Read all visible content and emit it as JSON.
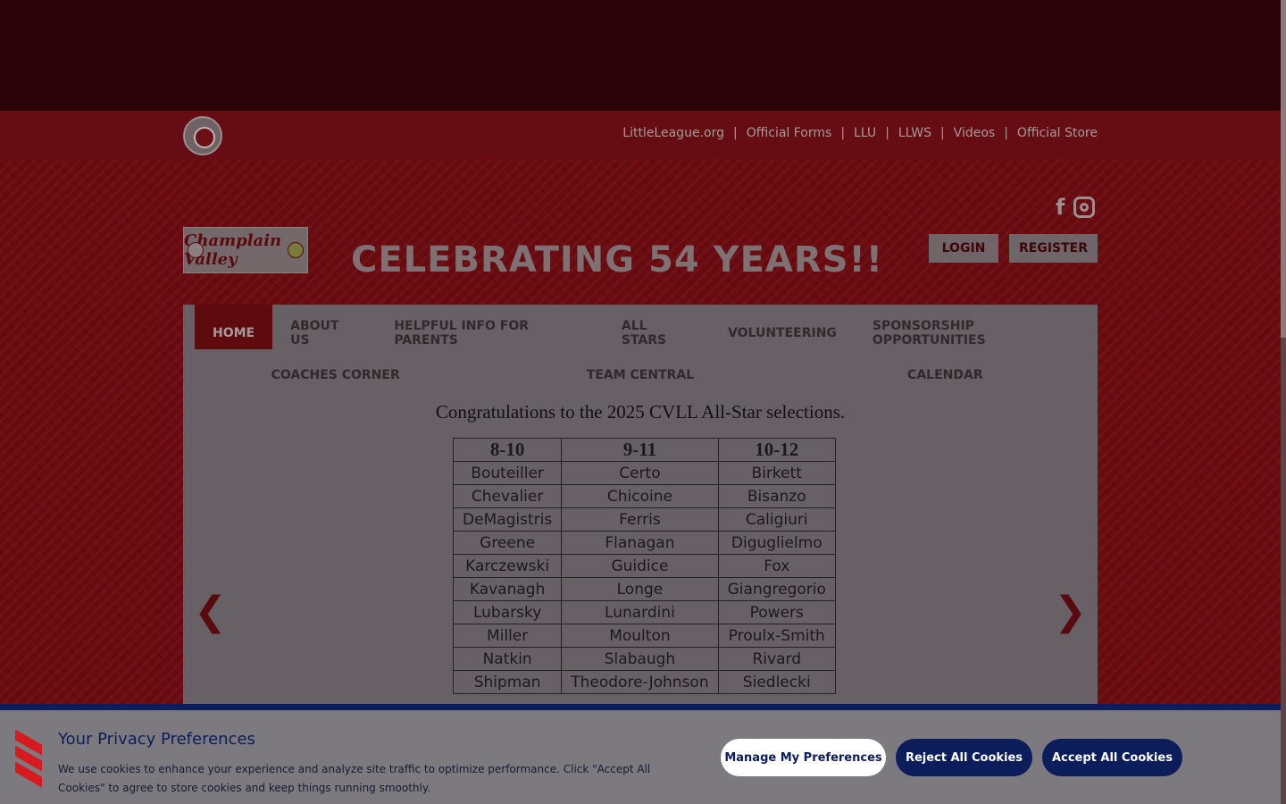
{
  "top_links": [
    "LittleLeague.org",
    "Official Forms",
    "LLU",
    "LLWS",
    "Videos",
    "Official Store"
  ],
  "league_logo_text": "Champlain Valley",
  "celebrate": "CELEBRATING 54 YEARS!!",
  "auth": {
    "login": "LOGIN",
    "register": "REGISTER"
  },
  "nav": {
    "row1": [
      "HOME",
      "ABOUT US",
      "HELPFUL INFO FOR PARENTS",
      "ALL STARS",
      "VOLUNTEERING",
      "SPONSORSHIP OPPORTUNITIES"
    ],
    "row2": [
      "COACHES CORNER",
      "TEAM CENTRAL",
      "CALENDAR"
    ]
  },
  "slide": {
    "headline": "Congratulations to the 2025 CVLL All-Star selections.",
    "columns": [
      "8-10",
      "9-11",
      "10-12"
    ],
    "rows": [
      [
        "Bouteiller",
        "Certo",
        "Birkett"
      ],
      [
        "Chevalier",
        "Chicoine",
        "Bisanzo"
      ],
      [
        "DeMagistris",
        "Ferris",
        "Caligiuri"
      ],
      [
        "Greene",
        "Flanagan",
        "Diguglielmo"
      ],
      [
        "Karczewski",
        "Guidice",
        "Fox"
      ],
      [
        "Kavanagh",
        "Longe",
        "Giangregorio"
      ],
      [
        "Lubarsky",
        "Lunardini",
        "Powers"
      ],
      [
        "Miller",
        "Moulton",
        "Proulx-Smith"
      ],
      [
        "Natkin",
        "Slabaugh",
        "Rivard"
      ],
      [
        "Shipman",
        "Theodore-Johnson",
        "Siedlecki"
      ]
    ],
    "prev": "❮",
    "next": "❯"
  },
  "cookie": {
    "title": "Your Privacy Preferences",
    "text": "We use cookies to enhance your experience and analyze site traffic to optimize performance. Click \"Accept All Cookies\" to agree to store cookies and keep things running smoothly.",
    "manage": "Manage My Preferences",
    "reject": "Reject All Cookies",
    "accept": "Accept All Cookies"
  },
  "colors": {
    "accent": "#0b1d5a",
    "brand_red": "#d71920"
  }
}
